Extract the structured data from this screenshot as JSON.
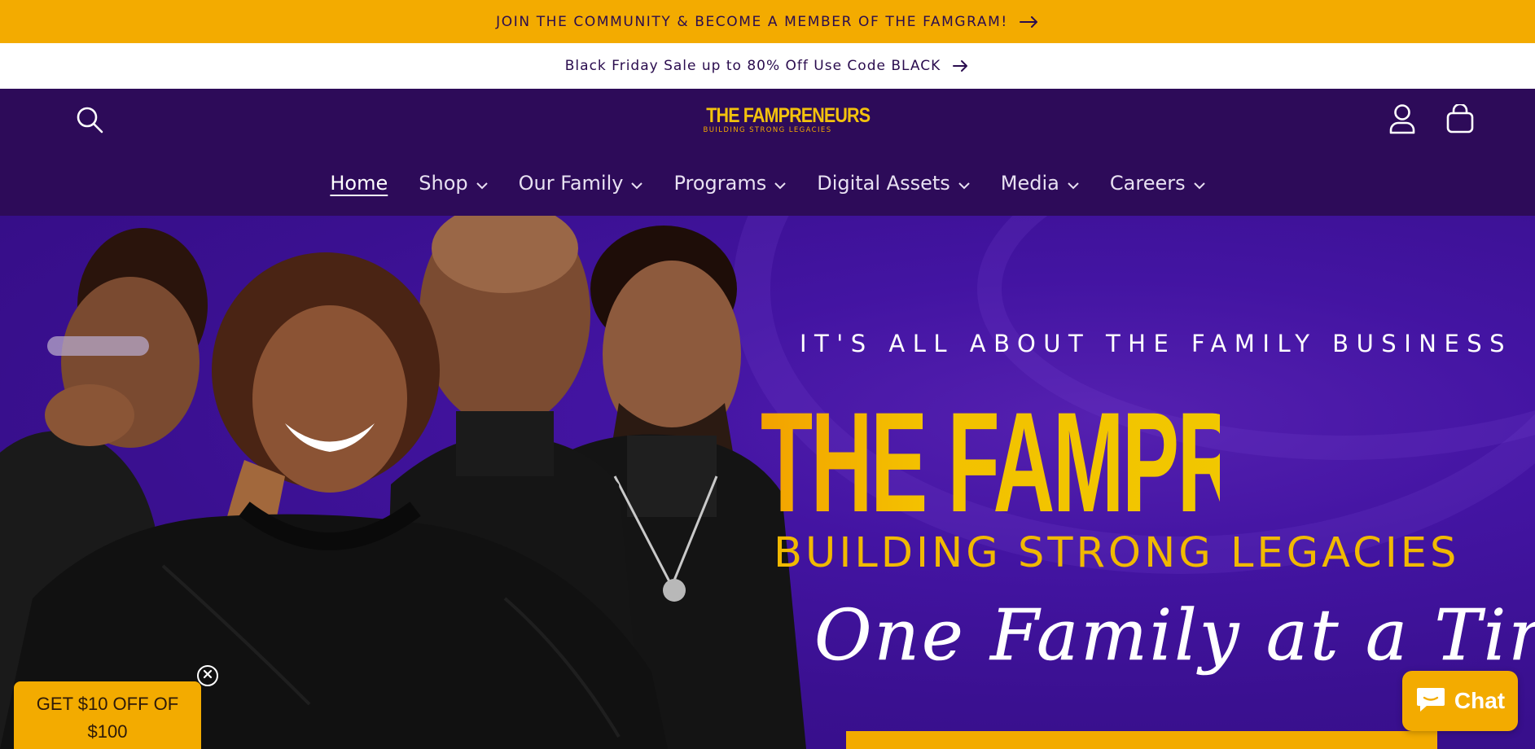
{
  "announcement": {
    "top": "JOIN THE COMMUNITY & BECOME A MEMBER OF THE FAMGRAM!",
    "sub": "Black Friday Sale up to 80% Off Use Code BLACK"
  },
  "header": {
    "logo_title": "THE FAMPRENEURS",
    "logo_subtitle": "BUILDING STRONG LEGACIES"
  },
  "nav": [
    {
      "label": "Home",
      "active": true,
      "dropdown": false
    },
    {
      "label": "Shop",
      "active": false,
      "dropdown": true
    },
    {
      "label": "Our Family",
      "active": false,
      "dropdown": true
    },
    {
      "label": "Programs",
      "active": false,
      "dropdown": true
    },
    {
      "label": "Digital Assets",
      "active": false,
      "dropdown": true
    },
    {
      "label": "Media",
      "active": false,
      "dropdown": true
    },
    {
      "label": "Careers",
      "active": false,
      "dropdown": true
    }
  ],
  "hero": {
    "tagline": "IT'S ALL ABOUT THE FAMILY BUSINESS",
    "brand": "THE FAMPRENEURS",
    "brand_sub": "BUILDING STRONG LEGACIES",
    "script": "One Family at a Time"
  },
  "promo": {
    "line1": "GET $10 OFF OF",
    "line2": "$100"
  },
  "chat": {
    "label": "Chat"
  },
  "colors": {
    "gold": "#f3ab00",
    "header_purple": "#2d0b59",
    "hero_purple": "#3a1090",
    "brand_yellow": "#f1c000"
  },
  "icons": [
    "arrow-right-icon",
    "search-icon",
    "account-icon",
    "cart-icon",
    "chevron-down-icon",
    "close-icon",
    "chat-bubble-icon"
  ]
}
